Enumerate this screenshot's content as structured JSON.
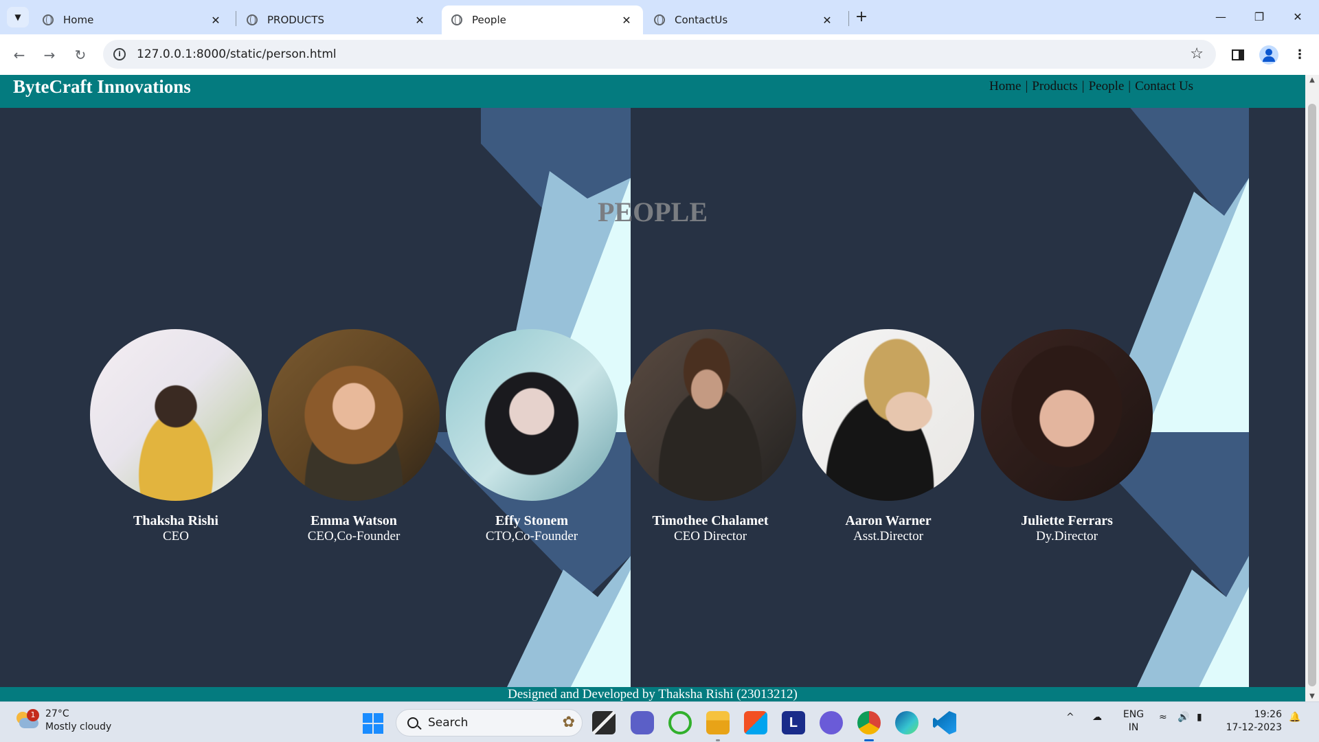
{
  "browser": {
    "tabs": [
      {
        "title": "Home"
      },
      {
        "title": "PRODUCTS"
      },
      {
        "title": "People"
      },
      {
        "title": "ContactUs"
      }
    ],
    "address": "127.0.0.1:8000/static/person.html"
  },
  "site": {
    "brand": "ByteCraft Innovations",
    "nav": [
      "Home",
      "Products",
      "People",
      "Contact Us"
    ],
    "nav_separator": "|",
    "heading": "PEOPLE",
    "people": [
      {
        "name": "Thaksha Rishi",
        "role": "CEO"
      },
      {
        "name": "Emma Watson",
        "role": "CEO,Co-Founder"
      },
      {
        "name": "Effy Stonem",
        "role": "CTO,Co-Founder"
      },
      {
        "name": "Timothee Chalamet",
        "role": "CEO Director"
      },
      {
        "name": "Aaron Warner",
        "role": "Asst.Director"
      },
      {
        "name": "Juliette Ferrars",
        "role": "Dy.Director"
      }
    ],
    "footer": "Designed and Developed by Thaksha Rishi (23013212)",
    "colors": {
      "header": "#047b7f",
      "background": "#273244",
      "shape_dark": "#3d5a80",
      "shape_mid": "#98c1d9",
      "shape_light": "#e0fbfc"
    }
  },
  "taskbar": {
    "weather_temp": "27°C",
    "weather_desc": "Mostly cloudy",
    "weather_badge": "1",
    "search_label": "Search",
    "lang_top": "ENG",
    "lang_bottom": "IN",
    "time": "19:26",
    "date": "17-12-2023"
  }
}
